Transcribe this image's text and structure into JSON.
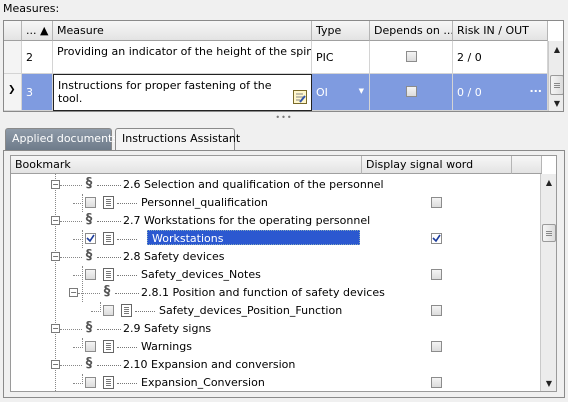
{
  "measures_label": "Measures:",
  "grid": {
    "columns": [
      "...",
      "Measure",
      "Type",
      "Depends on ...",
      "Risk IN / OUT"
    ],
    "rows": [
      {
        "num": "2",
        "measure": "Providing an indicator of the height of the spindle ...",
        "type": "PIC",
        "depends_checked": false,
        "risk": "2 / 0"
      },
      {
        "num": "3",
        "measure": "Instructions for proper fastening of the tool.",
        "type": "OI",
        "depends_checked": false,
        "risk": "0 / 0",
        "risk_more": "..."
      }
    ]
  },
  "tabs": [
    "Applied documents",
    "Instructions Assistant"
  ],
  "tree": {
    "columns": [
      "Bookmark",
      "Display signal word"
    ],
    "rows": [
      {
        "label": "2.6 Selection and qualification of the personnel",
        "kind": "section"
      },
      {
        "label": "Personnel_qualification",
        "kind": "doc",
        "checked": false,
        "signal": false
      },
      {
        "label": "2.7 Workstations for the operating personnel",
        "kind": "section"
      },
      {
        "label": "Workstations",
        "kind": "doc",
        "checked": true,
        "signal": true,
        "selected": true
      },
      {
        "label": "2.8 Safety devices",
        "kind": "section"
      },
      {
        "label": "Safety_devices_Notes",
        "kind": "doc",
        "checked": false,
        "signal": false
      },
      {
        "label": "2.8.1 Position and function of safety devices",
        "kind": "subsection"
      },
      {
        "label": "Safety_devices_Position_Function",
        "kind": "subdoc",
        "checked": false,
        "signal": false
      },
      {
        "label": "2.9 Safety signs",
        "kind": "section"
      },
      {
        "label": "Warnings",
        "kind": "doc",
        "checked": false,
        "signal": false
      },
      {
        "label": "2.10 Expansion and conversion",
        "kind": "section"
      },
      {
        "label": "Expansion_Conversion",
        "kind": "doc",
        "checked": false,
        "signal": false
      }
    ]
  },
  "colors": {
    "selection": "#7f9be0",
    "tree_selection": "#2b58d0",
    "active_tab": "#6e7b8a"
  }
}
